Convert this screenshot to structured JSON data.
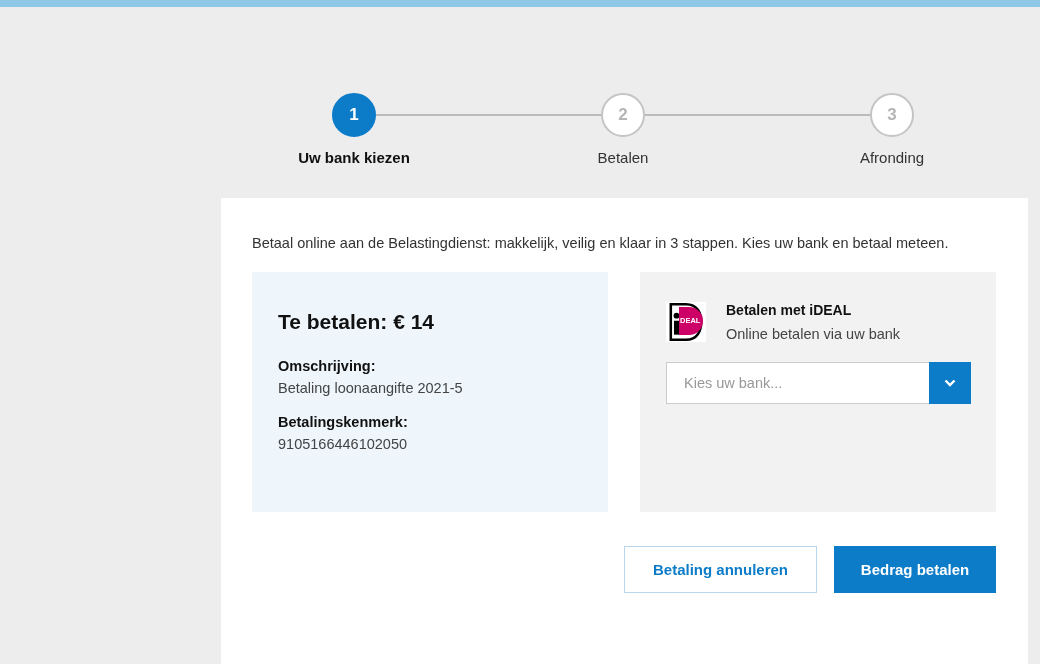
{
  "steps": [
    {
      "number": "1",
      "label": "Uw bank kiezen",
      "selected": true
    },
    {
      "number": "2",
      "label": "Betalen",
      "selected": false
    },
    {
      "number": "3",
      "label": "Afronding",
      "selected": false
    }
  ],
  "intro": "Betaal online aan de Belastingdienst: makkelijk, veilig en klaar in 3 stappen. Kies uw bank en betaal meteen.",
  "summary": {
    "title": "Te betalen: € 14",
    "fields": [
      {
        "label": "Omschrijving:",
        "value": "Betaling loonaangifte 2021-5"
      },
      {
        "label": "Betalingskenmerk:",
        "value": "9105166446102050"
      }
    ]
  },
  "ideal": {
    "logo_text": "DEAL",
    "title": "Betalen met iDEAL",
    "subtitle": "Online betalen via uw bank",
    "bank_select": {
      "placeholder": "Kies uw bank..."
    }
  },
  "buttons": [
    {
      "label": "Betaling annuleren",
      "kind": "secondary"
    },
    {
      "label": "Bedrag betalen",
      "kind": "primary"
    }
  ]
}
